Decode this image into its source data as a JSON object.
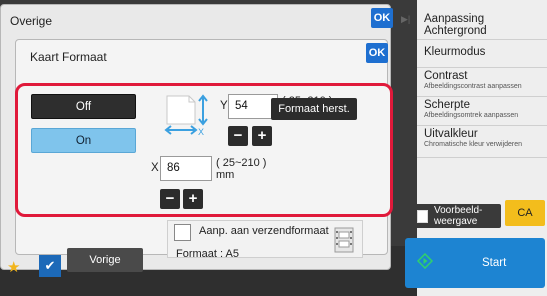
{
  "outer_dialog": {
    "title": "Overige",
    "ok_label": "OK"
  },
  "inner_dialog": {
    "title": "Kaart Formaat",
    "ok_label": "OK"
  },
  "toggle": {
    "off_label": "Off",
    "on_label": "On",
    "selected": "On"
  },
  "y_field": {
    "axis": "Y",
    "value": "54",
    "range": "( 25~210 )",
    "unit": "mm"
  },
  "x_field": {
    "axis": "X",
    "value": "86",
    "range": "( 25~210 )",
    "unit": "mm"
  },
  "stepper": {
    "minus": "−",
    "plus": "+"
  },
  "reset_label": "Formaat herst.",
  "adjust": {
    "checkbox_label": "Aanp. aan verzendformaat",
    "size_text": "Formaat  :  A5"
  },
  "sidebar": {
    "items": [
      {
        "label": "Aanpassing Achtergrond",
        "sub": ""
      },
      {
        "label": "Kleurmodus",
        "sub": ""
      },
      {
        "label": "Contrast",
        "sub": "Afbeeldingscontrast aanpassen"
      },
      {
        "label": "Scherpte",
        "sub": "Afbeeldingsomtrek aanpassen"
      },
      {
        "label": "Uitvalkleur",
        "sub": "Chromatische kleur verwijderen"
      }
    ]
  },
  "preview_label": "Voorbeeld-\nweergave",
  "ca_label": "CA",
  "start_label": "Start",
  "back_label": "Vorige",
  "colors": {
    "accent_blue": "#1e6fd0",
    "highlight_red": "#e0193a",
    "selected_on": "#7fc4ec",
    "ca_yellow": "#f3bd1c",
    "start_blue": "#1d84d2"
  }
}
